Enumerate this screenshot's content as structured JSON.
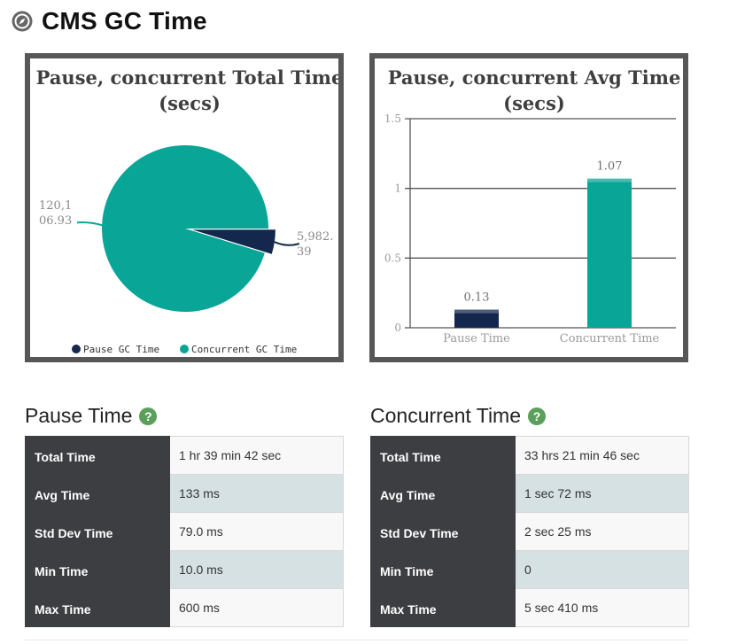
{
  "page": {
    "title": "CMS GC Time",
    "title_icon": "compass-icon"
  },
  "colors": {
    "pause": "#14284e",
    "concurrent": "#09a597",
    "frame": "#575757",
    "help": "#5aa05a"
  },
  "chart_data": [
    {
      "type": "pie",
      "title": "Pause, concurrent Total Time (secs)",
      "title_lines": [
        "Pause, concurrent Total Time",
        "(secs)"
      ],
      "slices": [
        {
          "name": "Pause GC Time",
          "value": 5982.39,
          "label_lines": [
            "5,982.",
            "39"
          ],
          "color": "#14284e"
        },
        {
          "name": "Concurrent GC Time",
          "value": 120106.93,
          "label_lines": [
            "120,1",
            "06.93"
          ],
          "color": "#09a597"
        }
      ],
      "legend": [
        "Pause GC Time",
        "Concurrent GC Time"
      ],
      "legend_position": "bottom"
    },
    {
      "type": "bar",
      "title": "Pause, concurrent Avg Time (secs)",
      "title_lines": [
        "Pause, concurrent Avg Time",
        "(secs)"
      ],
      "categories": [
        "Pause Time",
        "Concurrent Time"
      ],
      "values": [
        0.13,
        1.07
      ],
      "value_labels": [
        "0.13",
        "1.07"
      ],
      "colors": [
        "#14284e",
        "#09a597"
      ],
      "ylim": [
        0,
        1.5
      ],
      "yticks": [
        0,
        0.5,
        1,
        1.5
      ],
      "ytick_labels": [
        "0",
        "0.5",
        "1",
        "1.5"
      ],
      "grid": true
    }
  ],
  "pause": {
    "heading": "Pause Time",
    "help_label": "?",
    "rows": [
      {
        "label": "Total Time",
        "value": "1 hr 39 min 42 sec"
      },
      {
        "label": "Avg Time",
        "value": "133 ms"
      },
      {
        "label": "Std Dev Time",
        "value": "79.0 ms"
      },
      {
        "label": "Min Time",
        "value": "10.0 ms"
      },
      {
        "label": "Max Time",
        "value": "600 ms"
      }
    ]
  },
  "concurrent": {
    "heading": "Concurrent Time",
    "help_label": "?",
    "rows": [
      {
        "label": "Total Time",
        "value": "33 hrs 21 min 46 sec"
      },
      {
        "label": "Avg Time",
        "value": "1 sec 72 ms"
      },
      {
        "label": "Std Dev Time",
        "value": "2 sec 25 ms"
      },
      {
        "label": "Min Time",
        "value": "0"
      },
      {
        "label": "Max Time",
        "value": "5 sec 410 ms"
      }
    ]
  }
}
